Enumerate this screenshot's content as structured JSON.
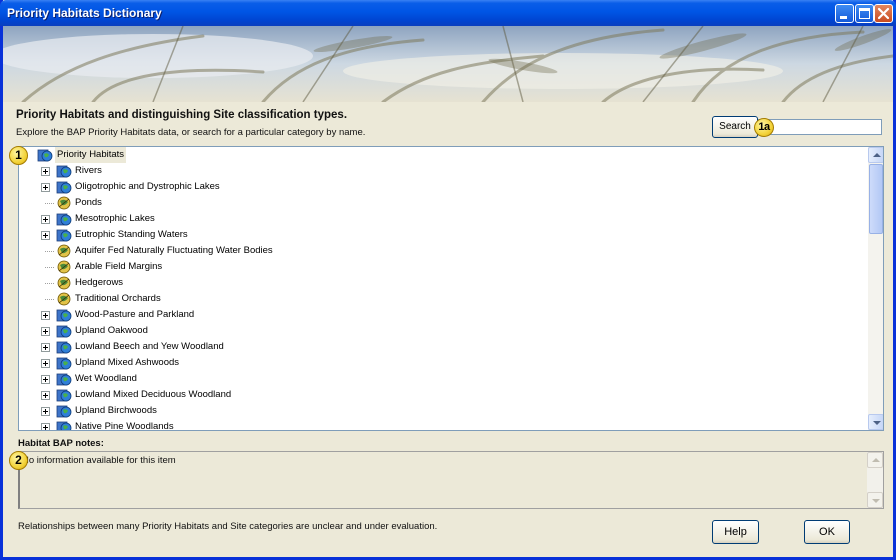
{
  "window": {
    "title": "Priority Habitats Dictionary"
  },
  "header": {
    "heading": "Priority Habitats and distinguishing Site classification types.",
    "subheading": "Explore the BAP Priority Habitats data, or search for a particular category by name."
  },
  "search": {
    "button_label": "Search",
    "value": "",
    "placeholder": ""
  },
  "callouts": {
    "tree": "1",
    "search": "1a",
    "notes": "2"
  },
  "tree": {
    "root_label": "Priority Habitats",
    "items": [
      {
        "label": "Rivers",
        "expandable": true,
        "icon": "globe-folder-icon"
      },
      {
        "label": "Oligotrophic and Dystrophic Lakes",
        "expandable": true,
        "icon": "globe-folder-icon"
      },
      {
        "label": "Ponds",
        "expandable": false,
        "icon": "globe-leaf-icon"
      },
      {
        "label": "Mesotrophic Lakes",
        "expandable": true,
        "icon": "globe-folder-icon"
      },
      {
        "label": "Eutrophic Standing Waters",
        "expandable": true,
        "icon": "globe-folder-icon"
      },
      {
        "label": "Aquifer Fed Naturally Fluctuating Water Bodies",
        "expandable": false,
        "icon": "globe-leaf-icon"
      },
      {
        "label": "Arable Field Margins",
        "expandable": false,
        "icon": "globe-leaf-icon"
      },
      {
        "label": "Hedgerows",
        "expandable": false,
        "icon": "globe-leaf-icon"
      },
      {
        "label": "Traditional Orchards",
        "expandable": false,
        "icon": "globe-leaf-icon"
      },
      {
        "label": "Wood-Pasture and Parkland",
        "expandable": true,
        "icon": "globe-folder-icon"
      },
      {
        "label": "Upland Oakwood",
        "expandable": true,
        "icon": "globe-folder-icon"
      },
      {
        "label": "Lowland Beech and Yew Woodland",
        "expandable": true,
        "icon": "globe-folder-icon"
      },
      {
        "label": "Upland Mixed Ashwoods",
        "expandable": true,
        "icon": "globe-folder-icon"
      },
      {
        "label": "Wet Woodland",
        "expandable": true,
        "icon": "globe-folder-icon"
      },
      {
        "label": "Lowland Mixed Deciduous Woodland",
        "expandable": true,
        "icon": "globe-folder-icon"
      },
      {
        "label": "Upland Birchwoods",
        "expandable": true,
        "icon": "globe-folder-icon"
      },
      {
        "label": "Native Pine Woodlands",
        "expandable": true,
        "icon": "globe-folder-icon"
      }
    ]
  },
  "notes": {
    "label": "Habitat BAP notes:",
    "text": "No information available for this item"
  },
  "footer": {
    "message": "Relationships between many Priority Habitats and Site categories are unclear and under evaluation.",
    "help_label": "Help",
    "ok_label": "OK"
  }
}
